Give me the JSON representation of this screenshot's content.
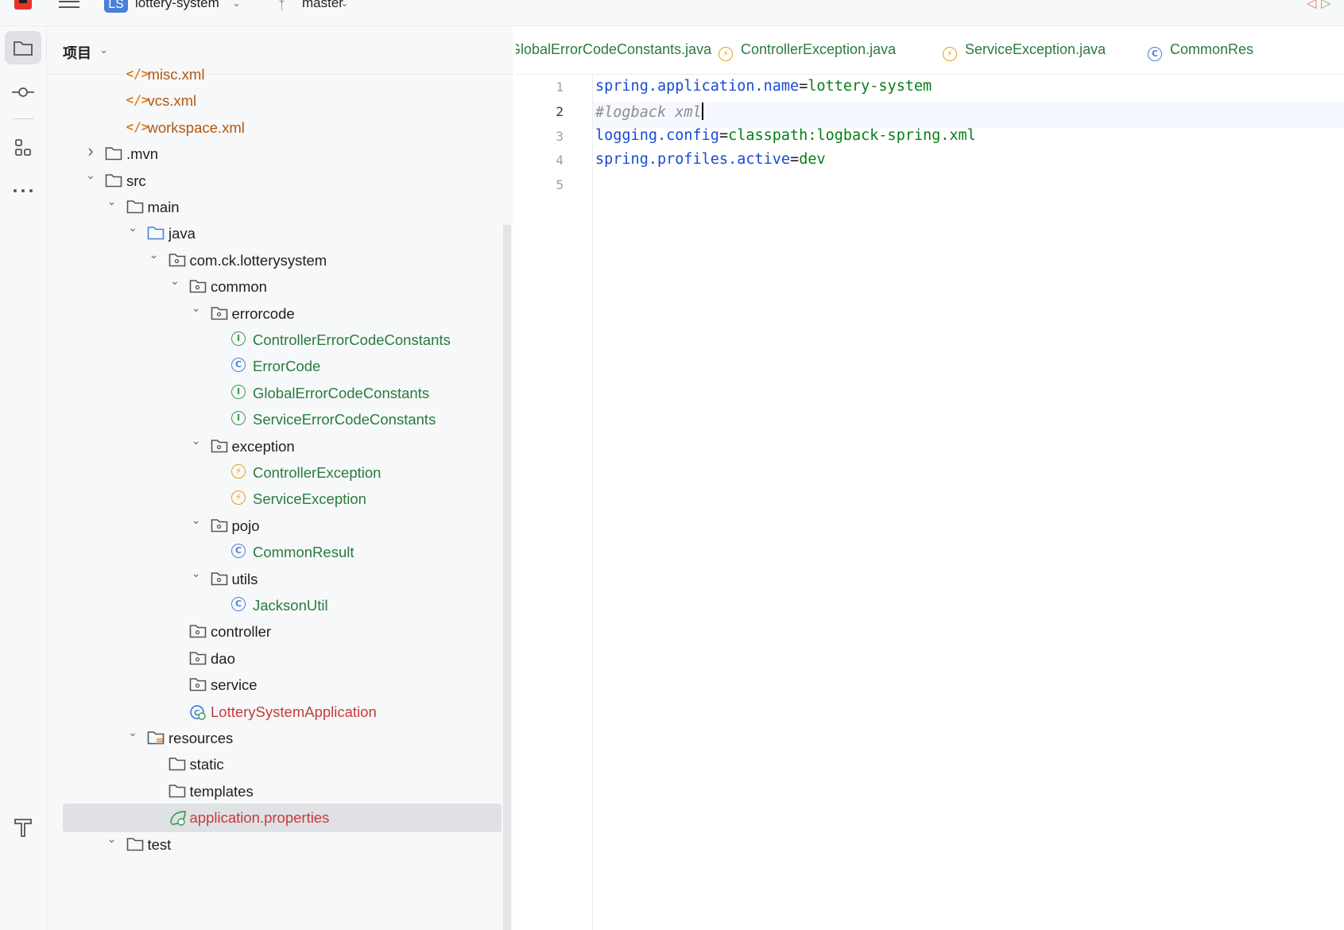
{
  "topbar": {
    "project_badge": "LS",
    "project_name": "lottery-system",
    "branch": "master"
  },
  "panel": {
    "title": "项目",
    "tree": [
      {
        "label": "misc.xml",
        "kind": "xml",
        "depth": 3,
        "chevron": "none",
        "color": "orange"
      },
      {
        "label": "vcs.xml",
        "kind": "xml",
        "depth": 3,
        "chevron": "none",
        "color": "orange"
      },
      {
        "label": "workspace.xml",
        "kind": "xml",
        "depth": 3,
        "chevron": "none",
        "color": "orange"
      },
      {
        "label": ".mvn",
        "kind": "folder",
        "depth": 2,
        "chevron": "right",
        "color": "dark"
      },
      {
        "label": "src",
        "kind": "folder",
        "depth": 2,
        "chevron": "down",
        "color": "dark"
      },
      {
        "label": "main",
        "kind": "folder",
        "depth": 3,
        "chevron": "down",
        "color": "dark"
      },
      {
        "label": "java",
        "kind": "folder-blue",
        "depth": 4,
        "chevron": "down",
        "color": "dark"
      },
      {
        "label": "com.ck.lotterysystem",
        "kind": "package",
        "depth": 5,
        "chevron": "down",
        "color": "dark"
      },
      {
        "label": "common",
        "kind": "package",
        "depth": 6,
        "chevron": "down",
        "color": "dark"
      },
      {
        "label": "errorcode",
        "kind": "package",
        "depth": 7,
        "chevron": "down",
        "color": "dark"
      },
      {
        "label": "ControllerErrorCodeConstants",
        "kind": "interface",
        "depth": 8,
        "chevron": "none",
        "color": "green"
      },
      {
        "label": "ErrorCode",
        "kind": "class",
        "depth": 8,
        "chevron": "none",
        "color": "green"
      },
      {
        "label": "GlobalErrorCodeConstants",
        "kind": "interface",
        "depth": 8,
        "chevron": "none",
        "color": "green"
      },
      {
        "label": "ServiceErrorCodeConstants",
        "kind": "interface",
        "depth": 8,
        "chevron": "none",
        "color": "green"
      },
      {
        "label": "exception",
        "kind": "package",
        "depth": 7,
        "chevron": "down",
        "color": "dark"
      },
      {
        "label": "ControllerException",
        "kind": "exception",
        "depth": 8,
        "chevron": "none",
        "color": "green"
      },
      {
        "label": "ServiceException",
        "kind": "exception",
        "depth": 8,
        "chevron": "none",
        "color": "green"
      },
      {
        "label": "pojo",
        "kind": "package",
        "depth": 7,
        "chevron": "down",
        "color": "dark"
      },
      {
        "label": "CommonResult",
        "kind": "class",
        "depth": 8,
        "chevron": "none",
        "color": "green"
      },
      {
        "label": "utils",
        "kind": "package",
        "depth": 7,
        "chevron": "down",
        "color": "dark"
      },
      {
        "label": "JacksonUtil",
        "kind": "class",
        "depth": 8,
        "chevron": "none",
        "color": "green"
      },
      {
        "label": "controller",
        "kind": "package",
        "depth": 6,
        "chevron": "none",
        "color": "dark"
      },
      {
        "label": "dao",
        "kind": "package",
        "depth": 6,
        "chevron": "none",
        "color": "dark"
      },
      {
        "label": "service",
        "kind": "package",
        "depth": 6,
        "chevron": "none",
        "color": "dark"
      },
      {
        "label": "LotterySystemApplication",
        "kind": "springboot",
        "depth": 6,
        "chevron": "none",
        "color": "red"
      },
      {
        "label": "resources",
        "kind": "folder-res",
        "depth": 4,
        "chevron": "down",
        "color": "dark"
      },
      {
        "label": "static",
        "kind": "folder",
        "depth": 5,
        "chevron": "none",
        "color": "dark"
      },
      {
        "label": "templates",
        "kind": "folder",
        "depth": 5,
        "chevron": "none",
        "color": "dark"
      },
      {
        "label": "application.properties",
        "kind": "properties",
        "depth": 5,
        "chevron": "none",
        "color": "red",
        "selected": true
      },
      {
        "label": "test",
        "kind": "folder",
        "depth": 3,
        "chevron": "down",
        "color": "dark"
      }
    ]
  },
  "editor": {
    "tabs": [
      {
        "label": "GlobalErrorCodeConstants.java",
        "icon": "none"
      },
      {
        "label": "ControllerException.java",
        "icon": "exception"
      },
      {
        "label": "ServiceException.java",
        "icon": "exception"
      },
      {
        "label": "CommonRes",
        "icon": "class"
      }
    ],
    "lines": [
      {
        "no": "1",
        "key": "spring.application.name",
        "eq": "=",
        "value": "lottery-system",
        "comment": ""
      },
      {
        "no": "2",
        "key": "",
        "eq": "",
        "value": "",
        "comment": "#logback xml"
      },
      {
        "no": "3",
        "key": "logging.config",
        "eq": "=",
        "value": "classpath:logback-spring.xml",
        "comment": ""
      },
      {
        "no": "4",
        "key": "spring.profiles.active",
        "eq": "=",
        "value": "dev",
        "comment": ""
      },
      {
        "no": "5",
        "key": "",
        "eq": "",
        "value": "",
        "comment": ""
      }
    ],
    "current_line": 2
  },
  "icons": {
    "folder": "folder-icon",
    "commit": "commit-icon",
    "structure": "structure-icon",
    "more": "more-icon",
    "build": "hammer-icon"
  }
}
